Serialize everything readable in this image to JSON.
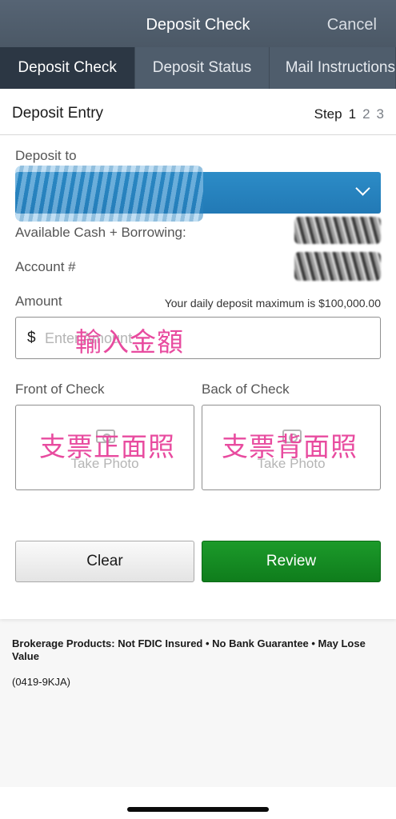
{
  "header": {
    "title": "Deposit Check",
    "cancel_label": "Cancel"
  },
  "tabs": [
    {
      "label": "Deposit Check"
    },
    {
      "label": "Deposit Status"
    },
    {
      "label": "Mail Instructions"
    }
  ],
  "entry": {
    "title": "Deposit Entry",
    "step_label": "Step",
    "steps": [
      "1",
      "2",
      "3"
    ]
  },
  "form": {
    "deposit_to_label": "Deposit to",
    "available_cash_label": "Available Cash + Borrowing:",
    "account_label": "Account #",
    "amount_label": "Amount",
    "daily_max_hint": "Your daily deposit maximum is $100,000.00",
    "currency_symbol": "$",
    "amount_placeholder": "Enter Amount",
    "amount_annotation": "輸入金額",
    "front_label": "Front of Check",
    "back_label": "Back of Check",
    "take_photo_label": "Take Photo",
    "front_annotation": "支票正面照",
    "back_annotation": "支票背面照"
  },
  "buttons": {
    "clear_label": "Clear",
    "review_label": "Review"
  },
  "footer": {
    "disclaimer": "Brokerage Products: Not FDIC Insured • No Bank Guarantee • May Lose Value",
    "code": "(0419-9KJA)"
  },
  "colors": {
    "accent_select": "#2279b5",
    "review_green": "#0f7d1c",
    "annotation_pink": "#e84b9f"
  }
}
